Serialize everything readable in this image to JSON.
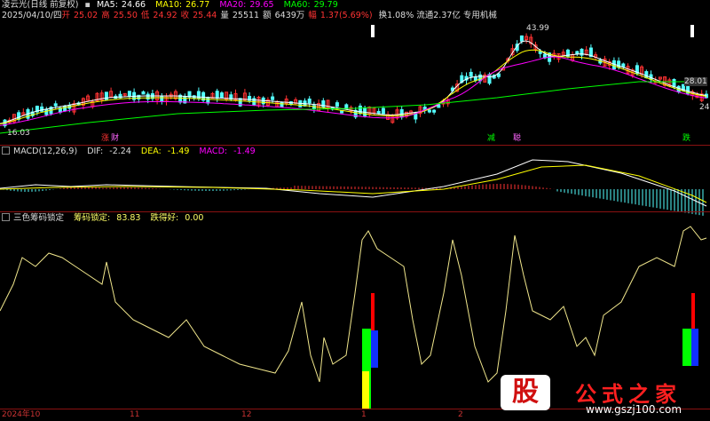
{
  "header": {
    "stock_name": "凌云光(日线 前复权)",
    "date": "2025/04/10/四",
    "open_label": "开",
    "open": "25.02",
    "high_label": "高",
    "high": "25.50",
    "low_label": "低",
    "low": "24.92",
    "close_label": "收",
    "close": "25.44",
    "vol_label": "量",
    "vol": "25511",
    "amount_label": "额",
    "amount": "6439万",
    "change_label": "幅",
    "change": "1.37(5.69%)",
    "turnover": "换1.08%",
    "float_cap": "流通2.37亿",
    "sector": "专用机械"
  },
  "ma": [
    {
      "label": "MA5:",
      "value": "24.66",
      "color": "#ffffff"
    },
    {
      "label": "MA10:",
      "value": "26.77",
      "color": "#ffff00"
    },
    {
      "label": "MA20:",
      "value": "29.65",
      "color": "#ff00ff"
    },
    {
      "label": "MA60:",
      "value": "29.79",
      "color": "#00ff00"
    }
  ],
  "price_annotations": {
    "high_mark": "43.99",
    "low_mark": "16.03",
    "right_price_1": "28.01",
    "right_price_2": "24"
  },
  "price_signals": {
    "sig1": "涨",
    "sig2": "财",
    "sig3": "减",
    "sig4": "聪",
    "sig5": "跌"
  },
  "macd": {
    "name": "MACD(12,26,9)",
    "dif_label": "DIF:",
    "dif": "-2.24",
    "dea_label": "DEA:",
    "dea": "-1.49",
    "macd_label": "MACD:",
    "macd": "-1.49"
  },
  "cyq": {
    "name": "三色筹码锁定",
    "lock_label": "筹码锁定:",
    "lock": "83.83",
    "drop_label": "跌得好:",
    "drop": "0.00"
  },
  "x_axis": {
    "labels": [
      "2024年10",
      "11",
      "12",
      "1",
      "2"
    ]
  },
  "watermark": {
    "logo": "股",
    "title": "公式之家",
    "url": "www.gszj100.com"
  },
  "colors": {
    "up": "#ff3333",
    "down": "#54ffff",
    "separator": "#8a1111",
    "ma5": "#ffffff",
    "ma10": "#ffff00",
    "ma20": "#ff00ff",
    "ma60": "#00ff00"
  }
}
